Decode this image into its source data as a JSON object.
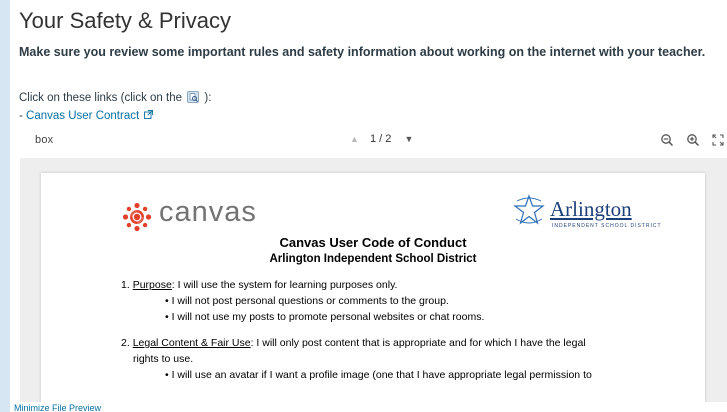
{
  "page": {
    "title": "Your Safety & Privacy",
    "subtitle": "Make sure you review some important rules and safety information about working on the internet with your teacher.",
    "instructions_before": "Click on these links (click on the",
    "instructions_after": "):",
    "inline_icon": "file-preview-icon",
    "link_dash": "-",
    "link_text": "Canvas User Contract",
    "link_icon": "external-link-icon"
  },
  "viewer": {
    "brand": "box",
    "page_indicator": "1 / 2",
    "icons": [
      "chevron-up-icon",
      "chevron-down-icon",
      "zoom-out-icon",
      "zoom-in-icon",
      "fullscreen-icon"
    ]
  },
  "document": {
    "canvas_logo_text": "canvas",
    "arlington_logo_text": "Arlington",
    "arlington_logo_sub": "INDEPENDENT SCHOOL DISTRICT",
    "title": "Canvas User Code of Conduct",
    "subtitle": "Arlington Independent School District",
    "items": [
      {
        "num": "1.",
        "heading": "Purpose",
        "text": ": I will use the system for learning purposes only.",
        "bullets": [
          "I will not post personal questions or comments to the group.",
          "I will not use my posts to promote personal websites or chat rooms."
        ]
      },
      {
        "num": "2.",
        "heading": "Legal Content & Fair Use",
        "text": ": I will only post content that is appropriate and for which I have the legal",
        "continuation": "rights to use.",
        "bullets": [
          "I will use an avatar if I want a profile image (one that I have appropriate legal permission to"
        ]
      }
    ]
  },
  "footer": {
    "minimize_label": "Minimize File Preview"
  },
  "colors": {
    "link": "#0770a3",
    "canvas_red": "#e4412b",
    "arlington_blue": "#1b3f7a",
    "background": "#d6e6f2"
  }
}
